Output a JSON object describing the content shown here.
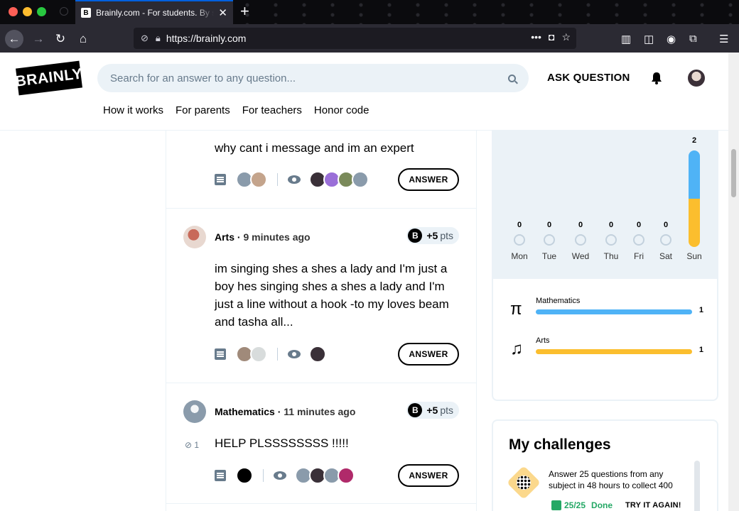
{
  "browser": {
    "tab_title": "Brainly.com - For students. By s",
    "tab_favicon": "B",
    "close_glyph": "✕",
    "new_tab_glyph": "+",
    "url": "https://brainly.com",
    "more_glyph": "•••"
  },
  "header": {
    "logo": "BRAINLY",
    "search_placeholder": "Search for an answer to any question...",
    "ask_label": "ASK QUESTION",
    "nav": [
      "How it works",
      "For parents",
      "For teachers",
      "Honor code"
    ]
  },
  "questions": [
    {
      "text": "why cant i message and im an expert",
      "answer_label": "ANSWER"
    },
    {
      "subject": "Arts",
      "sep": "·",
      "time": "9 minutes ago",
      "points_badge": "B",
      "points_value": "+5",
      "points_unit": "pts",
      "text": "im singing shes a shes a lady and I'm just a boy hes singing shes a shes a lady and I'm just a line without a hook -to my loves beam and tasha all...",
      "answer_label": "ANSWER"
    },
    {
      "subject": "Mathematics",
      "sep": "·",
      "time": "11 minutes ago",
      "points_badge": "B",
      "points_value": "+5",
      "points_unit": "pts",
      "attachments": "1",
      "text": "HELP PLSSSSSSSS !!!!!",
      "answer_label": "ANSWER"
    }
  ],
  "stats": {
    "days": [
      {
        "label": "Mon",
        "count": "0"
      },
      {
        "label": "Tue",
        "count": "0"
      },
      {
        "label": "Wed",
        "count": "0"
      },
      {
        "label": "Thu",
        "count": "0"
      },
      {
        "label": "Fri",
        "count": "0"
      },
      {
        "label": "Sat",
        "count": "0"
      },
      {
        "label": "Sun",
        "count": "2"
      }
    ],
    "subjects": [
      {
        "name": "Mathematics",
        "count": "1",
        "icon": "π",
        "color": "#4fb3f6"
      },
      {
        "name": "Arts",
        "count": "1",
        "icon": "♫",
        "color": "#fbbe2e"
      }
    ]
  },
  "challenges": {
    "title": "My challenges",
    "description": "Answer 25 questions from any subject in 48 hours to collect 400",
    "progress": "25/25",
    "status": "Done",
    "retry_label": "TRY IT AGAIN!"
  },
  "colors": {
    "accent_blue": "#4fb3f6",
    "accent_yellow": "#fbbe2e",
    "success_green": "#24a865"
  }
}
